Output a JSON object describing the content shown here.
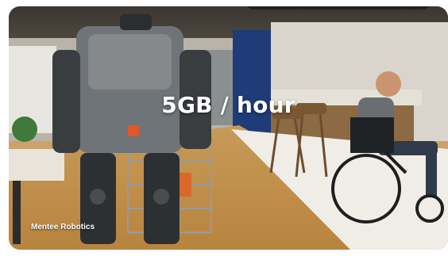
{
  "video": {
    "caption": "5GB / hour",
    "watermark": "Mentee Robotics"
  }
}
